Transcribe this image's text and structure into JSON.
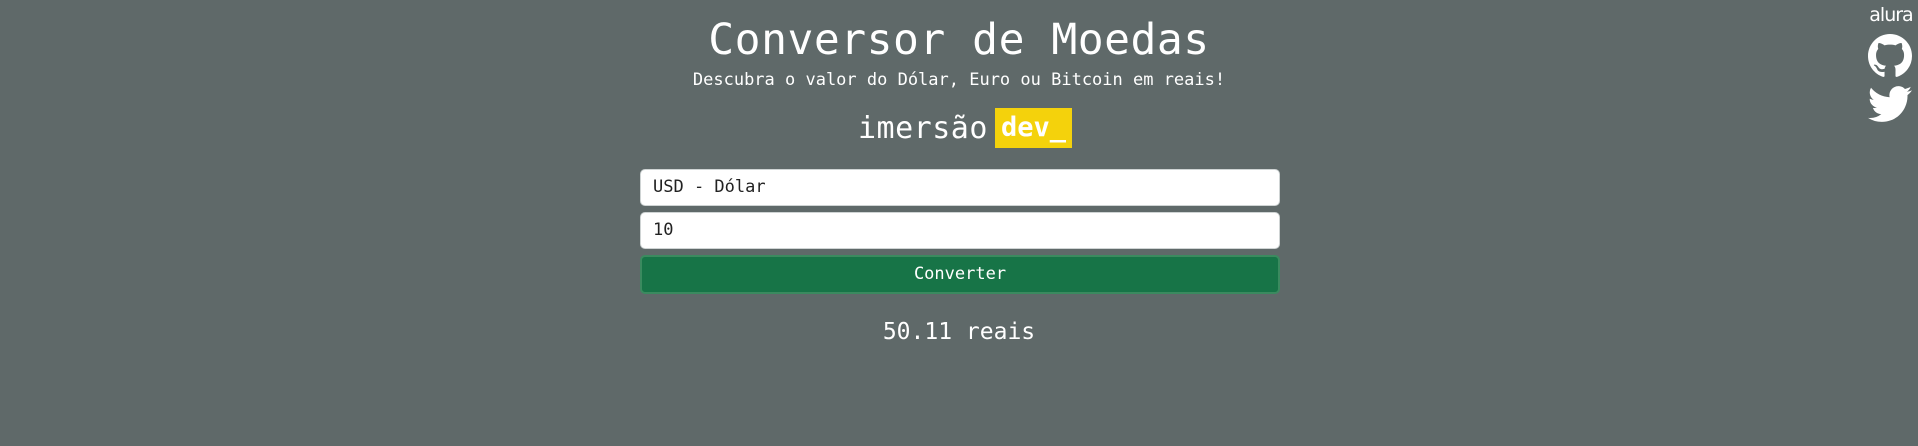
{
  "header": {
    "title": "Conversor de Moedas",
    "subtitle": "Descubra o valor do Dólar, Euro ou Bitcoin em reais!"
  },
  "brand": {
    "word": "imersão",
    "tag": "dev_",
    "tag_color": "#f4d20c"
  },
  "form": {
    "currency_selected": "USD - Dólar",
    "amount_value": "10",
    "convert_label": "Converter"
  },
  "result": {
    "text": "50.11 reais"
  },
  "side_links": {
    "alura_label": "alura",
    "github_icon": "github-icon",
    "twitter_icon": "twitter-icon"
  },
  "colors": {
    "background": "#5f6969",
    "button": "#177447",
    "accent": "#f4d20c"
  }
}
